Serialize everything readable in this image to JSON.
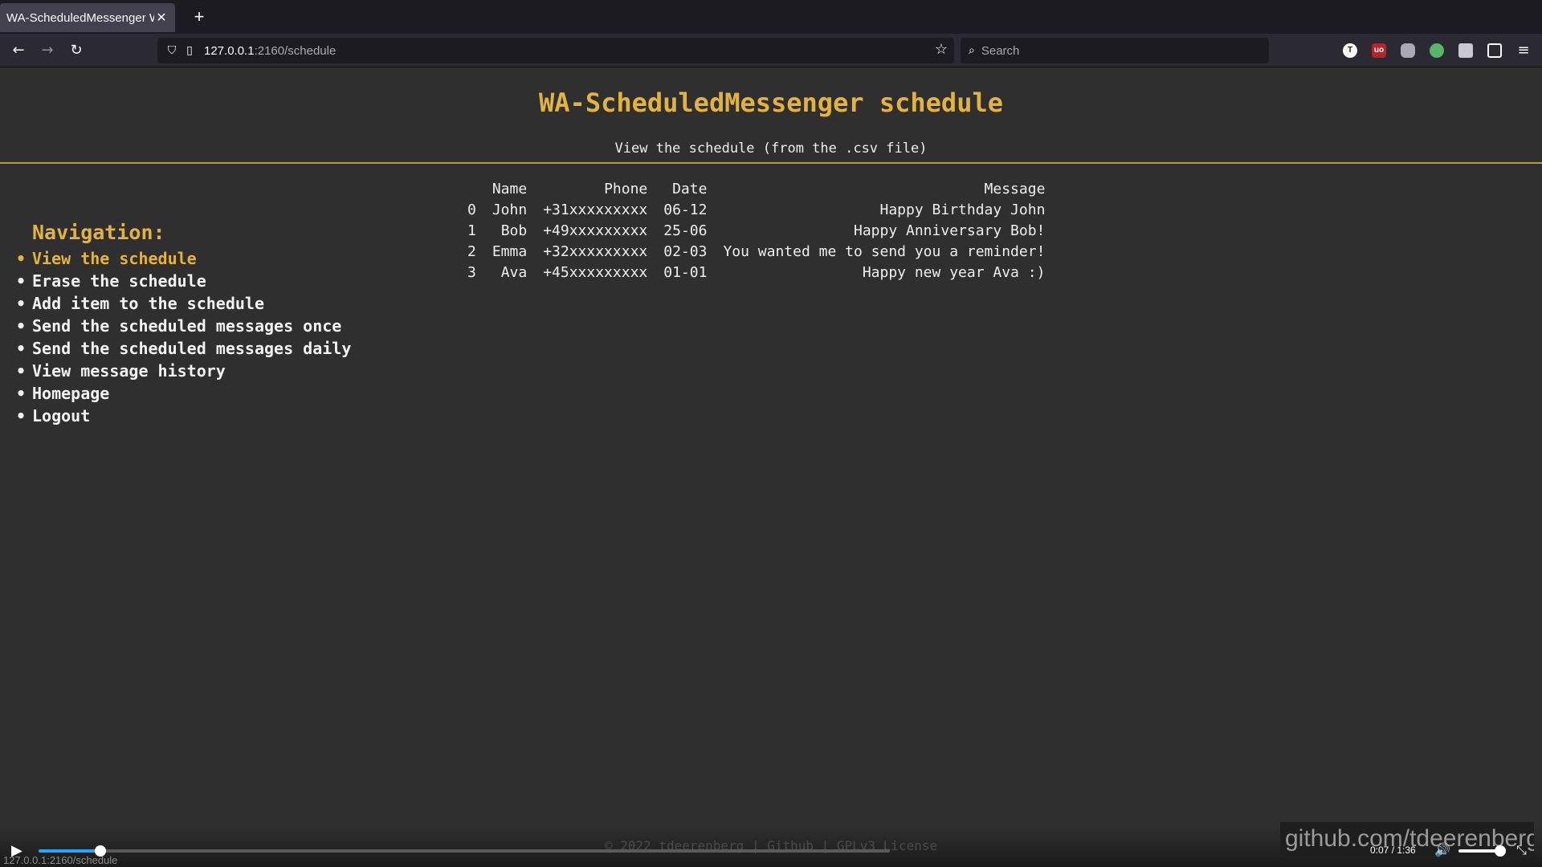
{
  "browser": {
    "tab_title": "WA-ScheduledMessenger W",
    "url_host": "127.0.0.1",
    "url_path": ":2160/schedule",
    "search_placeholder": "Search",
    "extension_labels": [
      "T",
      "uo",
      "",
      "",
      "",
      ""
    ]
  },
  "page": {
    "title": "WA-ScheduledMessenger schedule",
    "subtitle": "View the schedule (from the .csv file)"
  },
  "navigation": {
    "heading": "Navigation:",
    "bullet": "•",
    "items": [
      "View the schedule",
      "Erase the schedule",
      "Add item to the schedule",
      "Send the scheduled messages once",
      "Send the scheduled messages daily",
      "View message history",
      "Homepage",
      "Logout"
    ]
  },
  "schedule": {
    "headers": [
      "",
      "Name",
      "Phone",
      "Date",
      "Message"
    ],
    "rows": [
      [
        "0",
        "John",
        "+31xxxxxxxxx",
        "06-12",
        "Happy Birthday John"
      ],
      [
        "1",
        "Bob",
        "+49xxxxxxxxx",
        "25-06",
        "Happy Anniversary Bob!"
      ],
      [
        "2",
        "Emma",
        "+32xxxxxxxxx",
        "02-03",
        "You wanted me to send you a reminder!"
      ],
      [
        "3",
        "Ava",
        "+45xxxxxxxxx",
        "01-01",
        "Happy new year Ava :)"
      ]
    ]
  },
  "footer": {
    "text": "© 2022 tdeerenberg | Github | GPLv3 License"
  },
  "video": {
    "time": "0:07 / 1:36",
    "progress_fraction": 0.073,
    "watermark": "github.com/tdeerenberg"
  },
  "status_url": "127.0.0.1:2160/schedule",
  "colors": {
    "accent": "#e3b341",
    "background": "#2f2f2f",
    "progress": "#2aa3ff"
  }
}
